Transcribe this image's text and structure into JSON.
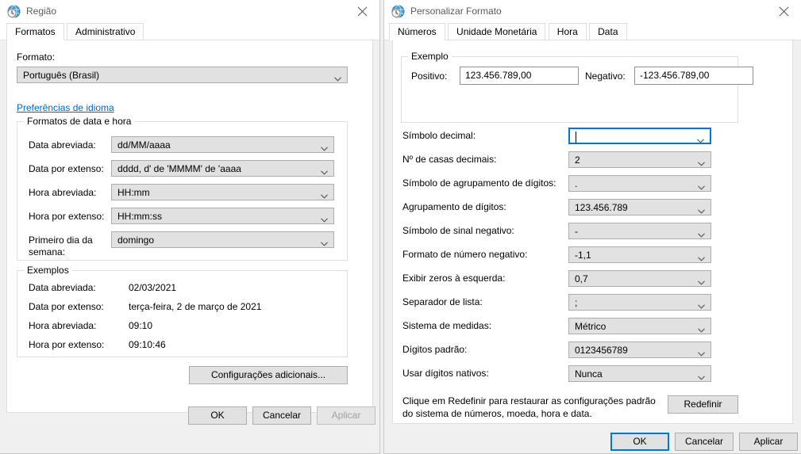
{
  "region_window": {
    "title": "Região",
    "icon": "region-globe-clock-icon",
    "close_label": "×",
    "tabs": [
      {
        "label": "Formatos",
        "active": true
      },
      {
        "label": "Administrativo",
        "active": false
      }
    ],
    "format_label": "Formato:",
    "format_value": "Português (Brasil)",
    "language_link": "Preferências de idioma",
    "datetime_group": {
      "title": "Formatos de data e hora",
      "rows": [
        {
          "label": "Data abreviada:",
          "value": "dd/MM/aaaa"
        },
        {
          "label": "Data por extenso:",
          "value": "dddd, d' de 'MMMM' de 'aaaa"
        },
        {
          "label": "Hora abreviada:",
          "value": "HH:mm"
        },
        {
          "label": "Hora por extenso:",
          "value": "HH:mm:ss"
        },
        {
          "label": "Primeiro dia da",
          "label2": "semana:",
          "value": "domingo"
        }
      ]
    },
    "examples_group": {
      "title": "Exemplos",
      "rows": [
        {
          "label": "Data abreviada:",
          "value": "02/03/2021"
        },
        {
          "label": "Data por extenso:",
          "value": "terça-feira, 2 de março de 2021"
        },
        {
          "label": "Hora abreviada:",
          "value": "09:10"
        },
        {
          "label": "Hora por extenso:",
          "value": "09:10:46"
        }
      ]
    },
    "additional_settings_button": "Configurações adicionais...",
    "buttons": {
      "ok": "OK",
      "cancel": "Cancelar",
      "apply": "Aplicar"
    }
  },
  "custom_window": {
    "title": "Personalizar Formato",
    "icon": "region-globe-clock-icon",
    "close_label": "×",
    "tabs": [
      {
        "label": "Números",
        "active": true
      },
      {
        "label": "Unidade Monetária",
        "active": false
      },
      {
        "label": "Hora",
        "active": false
      },
      {
        "label": "Data",
        "active": false
      }
    ],
    "example_group": {
      "title": "Exemplo",
      "positive_label": "Positivo:",
      "positive_value": "123.456.789,00",
      "negative_label": "Negativo:",
      "negative_value": "-123.456.789,00"
    },
    "settings": [
      {
        "label": "Símbolo decimal:",
        "value": "",
        "focused": true
      },
      {
        "label": "Nº de casas decimais:",
        "value": "2",
        "focused": false
      },
      {
        "label": "Símbolo de agrupamento de dígitos:",
        "value": ".",
        "focused": false
      },
      {
        "label": "Agrupamento de dígitos:",
        "value": "123.456.789",
        "focused": false
      },
      {
        "label": "Símbolo de sinal negativo:",
        "value": "-",
        "focused": false
      },
      {
        "label": "Formato de número negativo:",
        "value": "-1,1",
        "focused": false
      },
      {
        "label": "Exibir zeros à esquerda:",
        "value": "0,7",
        "focused": false
      },
      {
        "label": "Separador de lista:",
        "value": ";",
        "focused": false
      },
      {
        "label": "Sistema de medidas:",
        "value": "Métrico",
        "focused": false
      },
      {
        "label": "Dígitos padrão:",
        "value": "0123456789",
        "focused": false
      },
      {
        "label": "Usar dígitos nativos:",
        "value": "Nunca",
        "focused": false
      }
    ],
    "reset_note_line1": "Clique em Redefinir para restaurar as configurações padrão",
    "reset_note_line2": "do sistema de números, moeda, hora e data.",
    "reset_button": "Redefinir",
    "buttons": {
      "ok": "OK",
      "cancel": "Cancelar",
      "apply": "Aplicar"
    }
  },
  "theme": {
    "accent": "#0078d7",
    "link": "#0066cc",
    "control_bg": "#e1e1e1",
    "control_border": "#adadad",
    "window_bg": "#f0f0f0",
    "panel_bg": "#ffffff"
  }
}
